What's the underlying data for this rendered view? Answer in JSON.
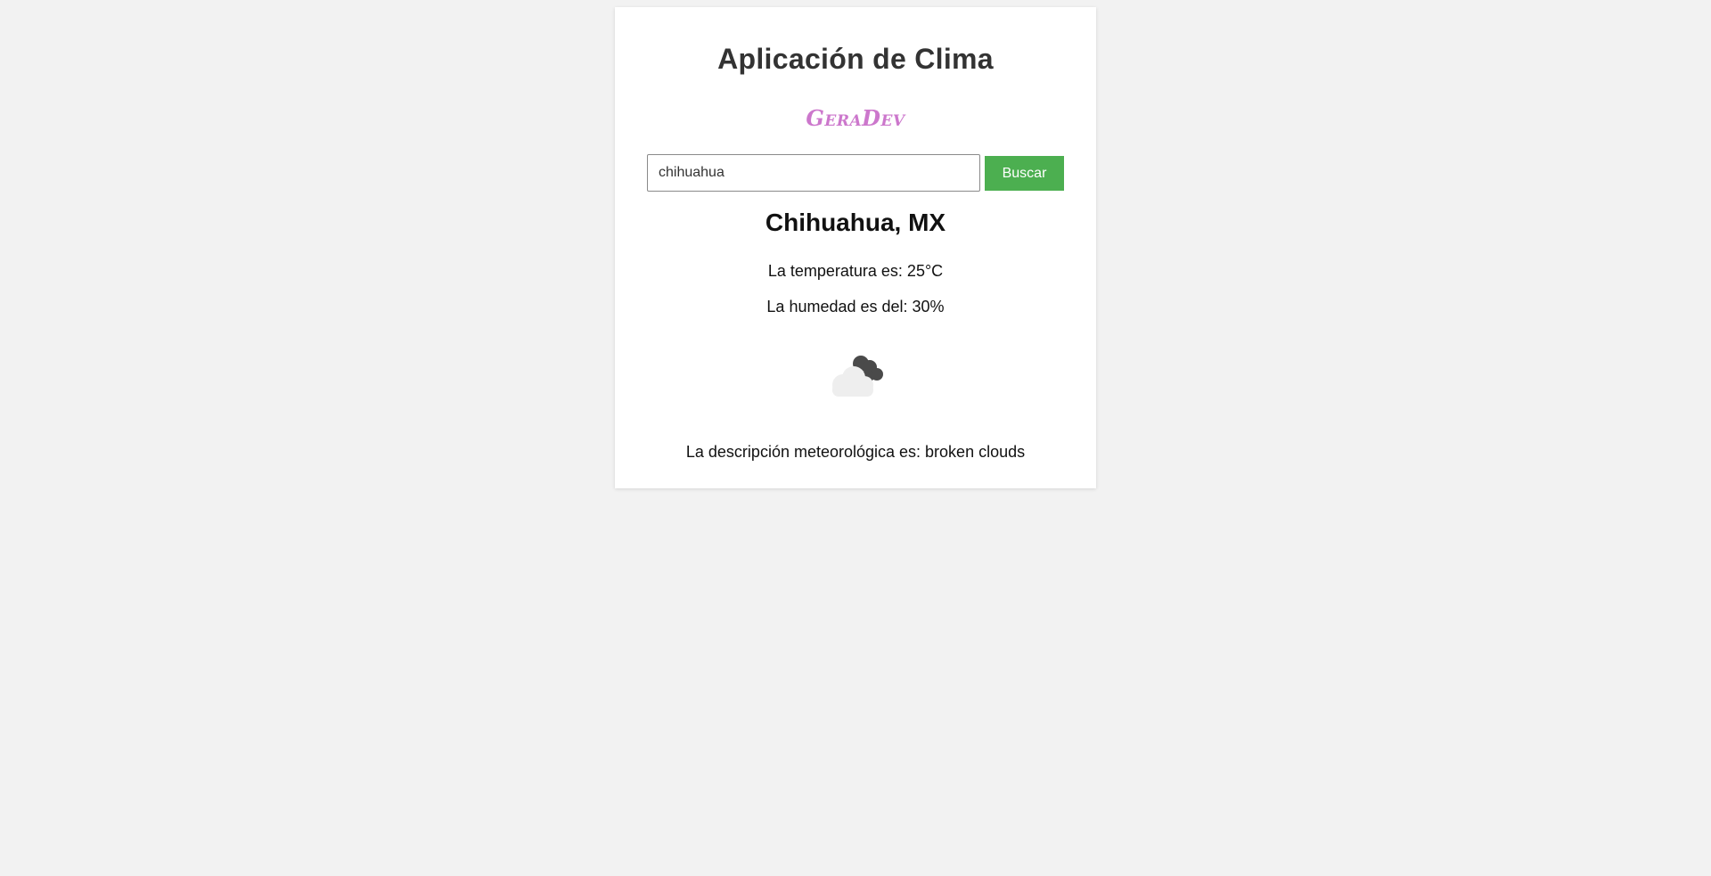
{
  "app": {
    "title": "Aplicación de Clima",
    "brand": "GeraDev"
  },
  "search": {
    "value": "chihuahua",
    "button_label": "Buscar"
  },
  "weather": {
    "city": "Chihuahua, MX",
    "temperature_text": "La temperatura es: 25°C",
    "humidity_text": "La humedad es del: 30%",
    "icon": "broken-clouds-icon",
    "description_text": "La descripción meteorológica es: broken clouds"
  },
  "colors": {
    "background": "#f2f2f2",
    "card": "#ffffff",
    "button": "#4caf50",
    "brand": "#cc77cc"
  }
}
